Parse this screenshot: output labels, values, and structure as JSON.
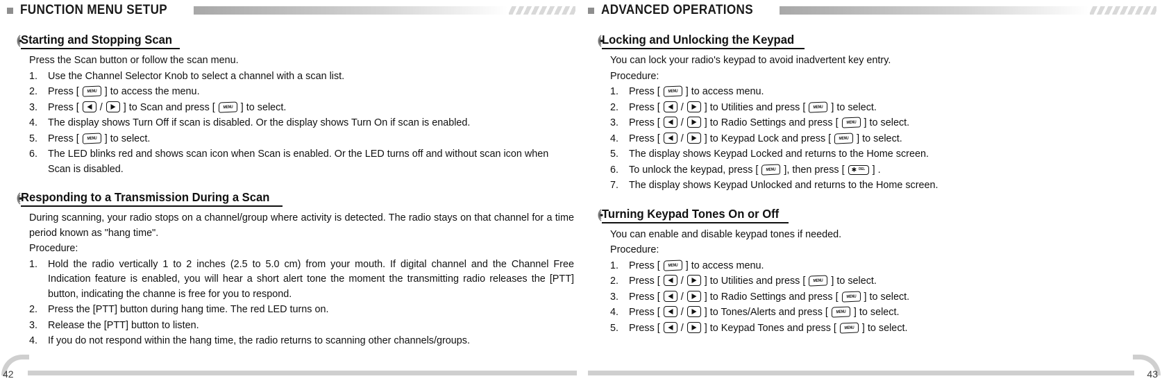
{
  "left_page": {
    "chapter": {
      "title": "FUNCTION MENU SETUP"
    },
    "page_number": "42",
    "sections": [
      {
        "heading": "Starting and Stopping Scan",
        "intro": "Press the Scan button or follow the scan menu.",
        "steps": [
          {
            "num": "1.",
            "parts": [
              {
                "t": "text",
                "v": "Use the Channel Selector Knob to select a channel  with a scan list."
              }
            ]
          },
          {
            "num": "2.",
            "parts": [
              {
                "t": "text",
                "v": "Press [ "
              },
              {
                "t": "key",
                "v": "menu"
              },
              {
                "t": "text",
                "v": " ] to access the menu."
              }
            ]
          },
          {
            "num": "3.",
            "parts": [
              {
                "t": "text",
                "v": "Press [ "
              },
              {
                "t": "key",
                "v": "left"
              },
              {
                "t": "text",
                "v": " / "
              },
              {
                "t": "key",
                "v": "right"
              },
              {
                "t": "text",
                "v": " ] to Scan and press [ "
              },
              {
                "t": "key",
                "v": "menu"
              },
              {
                "t": "text",
                "v": " ] to select."
              }
            ]
          },
          {
            "num": "4.",
            "parts": [
              {
                "t": "text",
                "v": "The display shows Turn Off if scan is disabled. Or the display shows Turn On if scan is enabled."
              }
            ]
          },
          {
            "num": "5.",
            "parts": [
              {
                "t": "text",
                "v": "Press [ "
              },
              {
                "t": "key",
                "v": "menu"
              },
              {
                "t": "text",
                "v": " ] to select."
              }
            ]
          },
          {
            "num": "6.",
            "parts": [
              {
                "t": "text",
                "v": "The LED blinks red and shows scan icon when Scan is enabled. Or the LED turns off and without scan icon when Scan is disabled."
              }
            ]
          }
        ]
      },
      {
        "heading": "Responding to a Transmission During a Scan",
        "intro": "During scanning, your radio stops on a channel/group where  activity  is  detected.  The  radio  stays on  that channel for a  time period known as \"hang time\".",
        "intro2": "Procedure:",
        "steps": [
          {
            "num": "1.",
            "justify": true,
            "parts": [
              {
                "t": "text",
                "v": "Hold the radio vertically 1 to 2 inches (2.5 to 5.0 cm) from your mouth. If digital channel and the Channel Free Indication feature is enabled, you will hear a short alert tone the moment the transmitting radio releases the [PTT] button,  indicating the channe is free for you to respond."
              }
            ]
          },
          {
            "num": "2.",
            "parts": [
              {
                "t": "text",
                "v": "Press the [PTT] button during hang time. The red LED turns on."
              }
            ]
          },
          {
            "num": "3.",
            "parts": [
              {
                "t": "text",
                "v": "Release the [PTT] button to listen."
              }
            ]
          },
          {
            "num": "4.",
            "parts": [
              {
                "t": "text",
                "v": "If you do not respond within the hang time, the radio returns to scanning other channels/groups."
              }
            ]
          }
        ]
      }
    ]
  },
  "right_page": {
    "chapter": {
      "title": "ADVANCED OPERATIONS"
    },
    "page_number": "43",
    "sections": [
      {
        "heading": "Locking and Unlocking the Keypad",
        "intro": "You can lock your radio's keypad to avoid inadvertent key entry.",
        "intro2": "Procedure:",
        "steps": [
          {
            "num": "1.",
            "parts": [
              {
                "t": "text",
                "v": "Press [ "
              },
              {
                "t": "key",
                "v": "menu"
              },
              {
                "t": "text",
                "v": " ] to access menu."
              }
            ]
          },
          {
            "num": "2.",
            "parts": [
              {
                "t": "text",
                "v": "Press [ "
              },
              {
                "t": "key",
                "v": "left"
              },
              {
                "t": "text",
                "v": " / "
              },
              {
                "t": "key",
                "v": "right"
              },
              {
                "t": "text",
                "v": " ] to Utilities and press [ "
              },
              {
                "t": "key",
                "v": "menu"
              },
              {
                "t": "text",
                "v": " ] to select."
              }
            ]
          },
          {
            "num": "3.",
            "parts": [
              {
                "t": "text",
                "v": "Press [ "
              },
              {
                "t": "key",
                "v": "left"
              },
              {
                "t": "text",
                "v": " / "
              },
              {
                "t": "key",
                "v": "right"
              },
              {
                "t": "text",
                "v": " ] to Radio Settings and press [ "
              },
              {
                "t": "key",
                "v": "menu"
              },
              {
                "t": "text",
                "v": " ] to select."
              }
            ]
          },
          {
            "num": "4.",
            "parts": [
              {
                "t": "text",
                "v": "Press [ "
              },
              {
                "t": "key",
                "v": "left"
              },
              {
                "t": "text",
                "v": " / "
              },
              {
                "t": "key",
                "v": "right"
              },
              {
                "t": "text",
                "v": " ] to Keypad Lock and press [ "
              },
              {
                "t": "key",
                "v": "menu"
              },
              {
                "t": "text",
                "v": " ] to select."
              }
            ]
          },
          {
            "num": "5.",
            "parts": [
              {
                "t": "text",
                "v": "The display shows Keypad Locked and returns to the Home screen."
              }
            ]
          },
          {
            "num": "6.",
            "parts": [
              {
                "t": "text",
                "v": "To unlock the keypad, press [ "
              },
              {
                "t": "key",
                "v": "menu"
              },
              {
                "t": "text",
                "v": " ], then press  [ "
              },
              {
                "t": "key",
                "v": "star-del"
              },
              {
                "t": "text",
                "v": " ] ."
              }
            ]
          },
          {
            "num": "7.",
            "parts": [
              {
                "t": "text",
                "v": "The display shows Keypad Unlocked and returns to the Home screen."
              }
            ]
          }
        ]
      },
      {
        "heading": "Turning Keypad Tones On or Off",
        "intro": "You can enable and disable keypad tones if needed.",
        "intro2": "Procedure:",
        "steps": [
          {
            "num": "1.",
            "parts": [
              {
                "t": "text",
                "v": "Press [ "
              },
              {
                "t": "key",
                "v": "menu"
              },
              {
                "t": "text",
                "v": " ] to access menu."
              }
            ]
          },
          {
            "num": "2.",
            "parts": [
              {
                "t": "text",
                "v": "Press [ "
              },
              {
                "t": "key",
                "v": "left"
              },
              {
                "t": "text",
                "v": " / "
              },
              {
                "t": "key",
                "v": "right"
              },
              {
                "t": "text",
                "v": " ] to Utilities and press [ "
              },
              {
                "t": "key",
                "v": "menu"
              },
              {
                "t": "text",
                "v": " ] to select."
              }
            ]
          },
          {
            "num": "3.",
            "parts": [
              {
                "t": "text",
                "v": "Press [ "
              },
              {
                "t": "key",
                "v": "left"
              },
              {
                "t": "text",
                "v": " / "
              },
              {
                "t": "key",
                "v": "right"
              },
              {
                "t": "text",
                "v": " ] to Radio Settings and press [ "
              },
              {
                "t": "key",
                "v": "menu"
              },
              {
                "t": "text",
                "v": " ] to select."
              }
            ]
          },
          {
            "num": "4.",
            "parts": [
              {
                "t": "text",
                "v": "Press [ "
              },
              {
                "t": "key",
                "v": "left"
              },
              {
                "t": "text",
                "v": " / "
              },
              {
                "t": "key",
                "v": "right"
              },
              {
                "t": "text",
                "v": " ] to Tones/Alerts and press [ "
              },
              {
                "t": "key",
                "v": "menu"
              },
              {
                "t": "text",
                "v": " ] to select."
              }
            ]
          },
          {
            "num": "5.",
            "parts": [
              {
                "t": "text",
                "v": "Press [ "
              },
              {
                "t": "key",
                "v": "left"
              },
              {
                "t": "text",
                "v": " / "
              },
              {
                "t": "key",
                "v": "right"
              },
              {
                "t": "text",
                "v": " ] to Keypad Tones and press [ "
              },
              {
                "t": "key",
                "v": "menu"
              },
              {
                "t": "text",
                "v": " ]  to select."
              }
            ]
          }
        ]
      }
    ]
  },
  "keys": {
    "menu_label": "MENU",
    "star_glyph": "✱",
    "del_label": "DEL"
  },
  "colors": {
    "chapter_bar_start": "#a8a8a8",
    "chapter_square": "#8e8e8e",
    "footer_rule": "#cfcfcf",
    "text": "#111111"
  }
}
